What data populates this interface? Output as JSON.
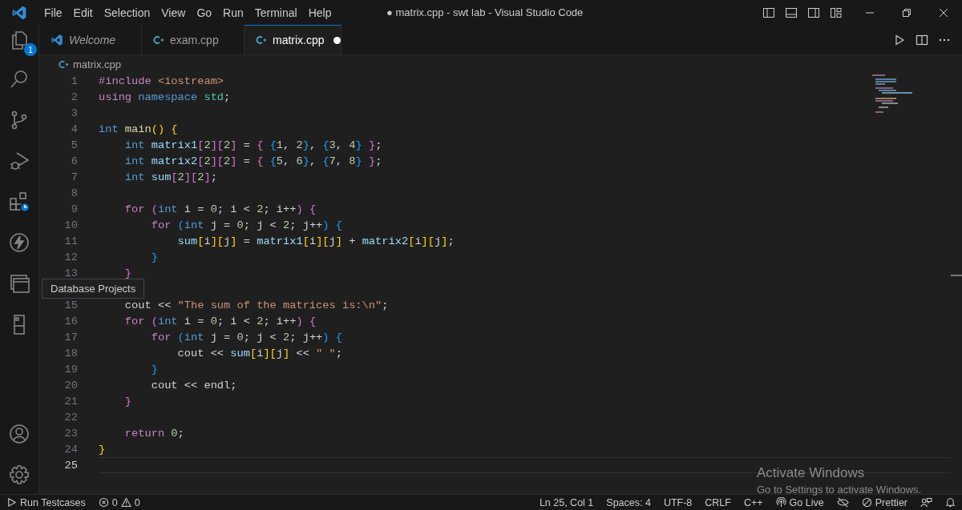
{
  "title_bar": {
    "menu": [
      "File",
      "Edit",
      "Selection",
      "View",
      "Go",
      "Run",
      "Terminal",
      "Help"
    ],
    "title": "● matrix.cpp - swt lab - Visual Studio Code"
  },
  "activity_bar": {
    "top": [
      {
        "kind": "explorer",
        "badge": "1"
      },
      {
        "kind": "search"
      },
      {
        "kind": "source-control"
      },
      {
        "kind": "run-debug"
      },
      {
        "kind": "extensions"
      },
      {
        "kind": "bolt"
      },
      {
        "kind": "database"
      },
      {
        "kind": "book"
      }
    ],
    "bottom": [
      {
        "kind": "account"
      },
      {
        "kind": "settings"
      }
    ]
  },
  "tooltip": "Database Projects",
  "tabs": [
    {
      "label": "Welcome",
      "kind": "welcome",
      "selected": false,
      "modified": false
    },
    {
      "label": "exam.cpp",
      "kind": "cpp",
      "selected": false,
      "modified": false
    },
    {
      "label": "matrix.cpp",
      "kind": "cpp",
      "selected": true,
      "modified": true
    }
  ],
  "breadcrumb": "matrix.cpp",
  "editor": {
    "lines": [
      {
        "number": "1",
        "current": false,
        "tokens": [
          {
            "kind": "kw",
            "text": "#include "
          },
          {
            "kind": "str",
            "text": "<iostream>"
          }
        ]
      },
      {
        "number": "2",
        "current": false,
        "tokens": [
          {
            "kind": "kw",
            "text": "using "
          },
          {
            "kind": "ty",
            "text": "namespace "
          },
          {
            "kind": "ns",
            "text": "std"
          },
          {
            "kind": "p",
            "text": ";"
          }
        ]
      },
      {
        "number": "3",
        "current": false
      },
      {
        "number": "4",
        "current": false,
        "tokens": [
          {
            "kind": "ty",
            "text": "int "
          },
          {
            "kind": "fn",
            "text": "main"
          },
          {
            "kind": "b1",
            "text": "() {"
          }
        ]
      },
      {
        "number": "5",
        "current": false,
        "tokens": [
          {
            "kind": "ty",
            "text": "    int "
          },
          {
            "kind": "v",
            "text": "matrix1"
          },
          {
            "kind": "b2",
            "text": "["
          },
          {
            "kind": "n",
            "text": "2"
          },
          {
            "kind": "b2",
            "text": "]["
          },
          {
            "kind": "n",
            "text": "2"
          },
          {
            "kind": "b2",
            "text": "]"
          },
          {
            "kind": "p",
            "text": " = "
          },
          {
            "kind": "b2",
            "text": "{ "
          },
          {
            "kind": "b3",
            "text": "{"
          },
          {
            "kind": "n",
            "text": "1"
          },
          {
            "kind": "p",
            "text": ", "
          },
          {
            "kind": "n",
            "text": "2"
          },
          {
            "kind": "b3",
            "text": "}"
          },
          {
            "kind": "p",
            "text": ", "
          },
          {
            "kind": "b3",
            "text": "{"
          },
          {
            "kind": "n",
            "text": "3"
          },
          {
            "kind": "p",
            "text": ", "
          },
          {
            "kind": "n",
            "text": "4"
          },
          {
            "kind": "b3",
            "text": "}"
          },
          {
            "kind": "b2",
            "text": " }"
          },
          {
            "kind": "p",
            "text": ";"
          }
        ]
      },
      {
        "number": "6",
        "current": false,
        "tokens": [
          {
            "kind": "ty",
            "text": "    int "
          },
          {
            "kind": "v",
            "text": "matrix2"
          },
          {
            "kind": "b2",
            "text": "["
          },
          {
            "kind": "n",
            "text": "2"
          },
          {
            "kind": "b2",
            "text": "]["
          },
          {
            "kind": "n",
            "text": "2"
          },
          {
            "kind": "b2",
            "text": "]"
          },
          {
            "kind": "p",
            "text": " = "
          },
          {
            "kind": "b2",
            "text": "{ "
          },
          {
            "kind": "b3",
            "text": "{"
          },
          {
            "kind": "n",
            "text": "5"
          },
          {
            "kind": "p",
            "text": ", "
          },
          {
            "kind": "n",
            "text": "6"
          },
          {
            "kind": "b3",
            "text": "}"
          },
          {
            "kind": "p",
            "text": ", "
          },
          {
            "kind": "b3",
            "text": "{"
          },
          {
            "kind": "n",
            "text": "7"
          },
          {
            "kind": "p",
            "text": ", "
          },
          {
            "kind": "n",
            "text": "8"
          },
          {
            "kind": "b3",
            "text": "}"
          },
          {
            "kind": "b2",
            "text": " }"
          },
          {
            "kind": "p",
            "text": ";"
          }
        ]
      },
      {
        "number": "7",
        "current": false,
        "tokens": [
          {
            "kind": "ty",
            "text": "    int "
          },
          {
            "kind": "v",
            "text": "sum"
          },
          {
            "kind": "b2",
            "text": "["
          },
          {
            "kind": "n",
            "text": "2"
          },
          {
            "kind": "b2",
            "text": "]["
          },
          {
            "kind": "n",
            "text": "2"
          },
          {
            "kind": "b2",
            "text": "]"
          },
          {
            "kind": "p",
            "text": ";"
          }
        ]
      },
      {
        "number": "8",
        "current": false
      },
      {
        "number": "9",
        "current": false,
        "tokens": [
          {
            "kind": "kw",
            "text": "    for "
          },
          {
            "kind": "b2",
            "text": "("
          },
          {
            "kind": "ty",
            "text": "int"
          },
          {
            "kind": "p",
            "text": " i = "
          },
          {
            "kind": "n",
            "text": "0"
          },
          {
            "kind": "p",
            "text": "; i < "
          },
          {
            "kind": "n",
            "text": "2"
          },
          {
            "kind": "p",
            "text": "; i++"
          },
          {
            "kind": "b2",
            "text": ") {"
          }
        ]
      },
      {
        "number": "10",
        "current": false,
        "tokens": [
          {
            "kind": "kw",
            "text": "        for "
          },
          {
            "kind": "b3",
            "text": "("
          },
          {
            "kind": "ty",
            "text": "int"
          },
          {
            "kind": "p",
            "text": " j = "
          },
          {
            "kind": "n",
            "text": "0"
          },
          {
            "kind": "p",
            "text": "; j < "
          },
          {
            "kind": "n",
            "text": "2"
          },
          {
            "kind": "p",
            "text": "; j++"
          },
          {
            "kind": "b3",
            "text": ") {"
          }
        ]
      },
      {
        "number": "11",
        "current": false,
        "tokens": [
          {
            "kind": "v",
            "text": "            sum"
          },
          {
            "kind": "b1",
            "text": "["
          },
          {
            "kind": "p",
            "text": "i"
          },
          {
            "kind": "b1",
            "text": "]["
          },
          {
            "kind": "p",
            "text": "j"
          },
          {
            "kind": "b1",
            "text": "]"
          },
          {
            "kind": "p",
            "text": " = "
          },
          {
            "kind": "v",
            "text": "matrix1"
          },
          {
            "kind": "b1",
            "text": "["
          },
          {
            "kind": "p",
            "text": "i"
          },
          {
            "kind": "b1",
            "text": "]["
          },
          {
            "kind": "p",
            "text": "j"
          },
          {
            "kind": "b1",
            "text": "]"
          },
          {
            "kind": "p",
            "text": " + "
          },
          {
            "kind": "v",
            "text": "matrix2"
          },
          {
            "kind": "b1",
            "text": "["
          },
          {
            "kind": "p",
            "text": "i"
          },
          {
            "kind": "b1",
            "text": "]["
          },
          {
            "kind": "p",
            "text": "j"
          },
          {
            "kind": "b1",
            "text": "]"
          },
          {
            "kind": "p",
            "text": ";"
          }
        ]
      },
      {
        "number": "12",
        "current": false,
        "tokens": [
          {
            "kind": "b3",
            "text": "        }"
          }
        ]
      },
      {
        "number": "13",
        "current": false,
        "tokens": [
          {
            "kind": "b2",
            "text": "    }"
          }
        ]
      },
      {
        "current": false
      },
      {
        "number": "15",
        "current": false,
        "tokens": [
          {
            "kind": "p",
            "text": "    cout << "
          },
          {
            "kind": "str",
            "text": "\"The sum of the matrices is:\\n\""
          },
          {
            "kind": "p",
            "text": ";"
          }
        ]
      },
      {
        "number": "16",
        "current": false,
        "tokens": [
          {
            "kind": "kw",
            "text": "    for "
          },
          {
            "kind": "b2",
            "text": "("
          },
          {
            "kind": "ty",
            "text": "int"
          },
          {
            "kind": "p",
            "text": " i = "
          },
          {
            "kind": "n",
            "text": "0"
          },
          {
            "kind": "p",
            "text": "; i < "
          },
          {
            "kind": "n",
            "text": "2"
          },
          {
            "kind": "p",
            "text": "; i++"
          },
          {
            "kind": "b2",
            "text": ") {"
          }
        ]
      },
      {
        "number": "17",
        "current": false,
        "tokens": [
          {
            "kind": "kw",
            "text": "        for "
          },
          {
            "kind": "b3",
            "text": "("
          },
          {
            "kind": "ty",
            "text": "int"
          },
          {
            "kind": "p",
            "text": " j = "
          },
          {
            "kind": "n",
            "text": "0"
          },
          {
            "kind": "p",
            "text": "; j < "
          },
          {
            "kind": "n",
            "text": "2"
          },
          {
            "kind": "p",
            "text": "; j++"
          },
          {
            "kind": "b3",
            "text": ") {"
          }
        ]
      },
      {
        "number": "18",
        "current": false,
        "tokens": [
          {
            "kind": "p",
            "text": "            cout << "
          },
          {
            "kind": "v",
            "text": "sum"
          },
          {
            "kind": "b1",
            "text": "["
          },
          {
            "kind": "p",
            "text": "i"
          },
          {
            "kind": "b1",
            "text": "]["
          },
          {
            "kind": "p",
            "text": "j"
          },
          {
            "kind": "b1",
            "text": "]"
          },
          {
            "kind": "p",
            "text": " << "
          },
          {
            "kind": "str",
            "text": "\" \""
          },
          {
            "kind": "p",
            "text": ";"
          }
        ]
      },
      {
        "number": "19",
        "current": false,
        "tokens": [
          {
            "kind": "b3",
            "text": "        }"
          }
        ]
      },
      {
        "number": "20",
        "current": false,
        "tokens": [
          {
            "kind": "p",
            "text": "        cout << endl;"
          }
        ]
      },
      {
        "number": "21",
        "current": false,
        "tokens": [
          {
            "kind": "b2",
            "text": "    }"
          }
        ]
      },
      {
        "number": "22",
        "current": false
      },
      {
        "number": "23",
        "current": false,
        "tokens": [
          {
            "kind": "kw",
            "text": "    return "
          },
          {
            "kind": "n",
            "text": "0"
          },
          {
            "kind": "p",
            "text": ";"
          }
        ]
      },
      {
        "number": "24",
        "current": false,
        "tokens": [
          {
            "kind": "b1",
            "text": "}"
          }
        ]
      },
      {
        "number": "25",
        "current": true
      }
    ]
  },
  "notice": {
    "title": "Activate Windows",
    "text": "Go to Settings to activate Windows."
  },
  "status_bar": {
    "left": [
      {
        "kind": "run",
        "text": "Run Testcases"
      },
      {
        "kind": "problems",
        "errors": "0",
        "warnings": "0"
      }
    ],
    "right": [
      {
        "kind": "text",
        "text": "Ln 25, Col 1"
      },
      {
        "kind": "text",
        "text": "Spaces: 4"
      },
      {
        "kind": "text",
        "text": "UTF-8"
      },
      {
        "kind": "text",
        "text": "CRLF"
      },
      {
        "kind": "text",
        "text": "C++"
      },
      {
        "kind": "live",
        "text": "Go Live"
      },
      {
        "kind": "eye-off"
      },
      {
        "kind": "prettier",
        "text": "Prettier"
      },
      {
        "kind": "feedback"
      },
      {
        "kind": "bell"
      }
    ]
  }
}
